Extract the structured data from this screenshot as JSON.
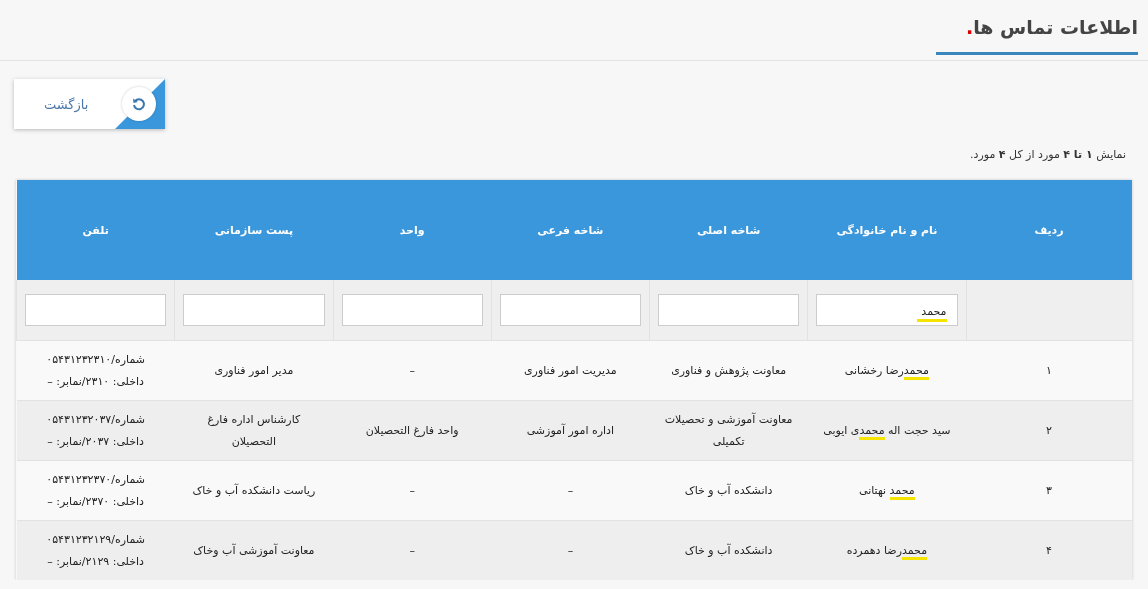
{
  "page": {
    "title": "اطلاعات تماس ها",
    "title_dot": "."
  },
  "back_button": {
    "label": "بازگشت"
  },
  "summary": "نمایش **۱ تا ۴** مورد از کل **۴** مورد.",
  "table": {
    "columns": [
      "ردیف",
      "نام و نام خانوادگی",
      "شاخه اصلی",
      "شاخه فرعی",
      "واحد",
      "پست سازمانی",
      "تلفن"
    ],
    "filters": [
      {
        "value": "محمد",
        "highlight": true
      },
      {
        "highlight": false
      },
      {
        "highlight": false
      },
      {
        "highlight": false
      },
      {
        "highlight": false
      },
      {
        "highlight": false
      }
    ],
    "rows": [
      {
        "index": "۱",
        "name": {
          "match": "محمد",
          "after": "رضا رخشانی"
        },
        "main_branch": "معاونت پژوهش و فناوری",
        "sub_branch": "مدیریت امور فناوری",
        "unit": "–",
        "position": "مدیر امور فناوری",
        "phone": "شماره/۰۵۴۳۱۲۳۲۳۱۰",
        "extension": "داخلی: ۲۳۱۰/نمابر: –"
      },
      {
        "index": "۲",
        "name": {
          "before": "سید حجت اله ",
          "match": "محمد",
          "after": "ی ایوبی"
        },
        "main_branch": "معاونت آموزشی و تحصیلات تکمیلی",
        "sub_branch": "اداره امور آموزشی",
        "unit": "واحد فارغ التحصیلان",
        "position": "کارشناس اداره فارغ التحصیلان",
        "phone": "شماره/۰۵۴۳۱۲۳۲۰۳۷",
        "extension": "داخلی: ۲۰۳۷/نمابر: –"
      },
      {
        "index": "۳",
        "name": {
          "match": "محمد",
          "after": " نهتانی"
        },
        "main_branch": "دانشکده آب و خاک",
        "sub_branch": "–",
        "unit": "–",
        "position": "ریاست دانشکده آب و خاک",
        "phone": "شماره/۰۵۴۳۱۲۳۲۳۷۰",
        "extension": "داخلی: ۲۳۷۰/نمابر: –"
      },
      {
        "index": "۴",
        "name": {
          "match": "محمد",
          "after": "رضا دهمرده"
        },
        "main_branch": "دانشکده آب و خاک",
        "sub_branch": "–",
        "unit": "–",
        "position": "معاونت آموزشی آب وخاک",
        "phone": "شماره/۰۵۴۳۱۲۳۲۱۲۹",
        "extension": "داخلی: ۲۱۲۹/نمابر: –"
      }
    ]
  }
}
